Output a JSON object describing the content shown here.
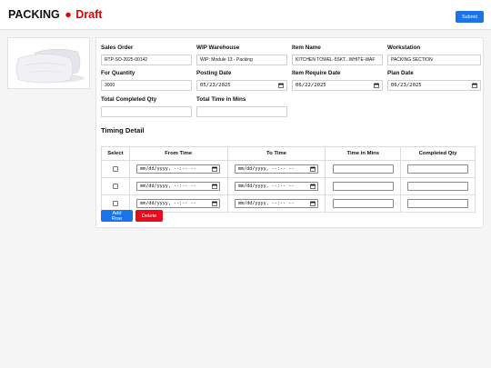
{
  "header": {
    "title": "PACKING",
    "status_dot": "●",
    "status": "Draft",
    "submit_label": "Submit"
  },
  "form": {
    "sales_order": {
      "label": "Sales Order",
      "value": "RTP-SO-2025-00142"
    },
    "wip_warehouse": {
      "label": "WIP Warehouse",
      "value": "WIP: Module 13 - Packing"
    },
    "item_name": {
      "label": "Item Name",
      "value": "KITCHEN TOWEL-5SKT...WHITE-WAF"
    },
    "workstation": {
      "label": "Workstation",
      "value": "PACKING SECTION"
    },
    "for_quantity": {
      "label": "For Quantity",
      "value": "3000"
    },
    "posting_date": {
      "label": "Posting Date",
      "value": "05/23/2025"
    },
    "item_require_date": {
      "label": "Item Require Date",
      "value": "06/22/2025"
    },
    "plan_date": {
      "label": "Plan Date",
      "value": "06/23/2025"
    },
    "total_completed_qty": {
      "label": "Total Completed Qty",
      "value": ""
    },
    "total_time_in_mins": {
      "label": "Total Time in Mins",
      "value": ""
    }
  },
  "timing": {
    "title": "Timing Detail",
    "columns": [
      "Select",
      "From Time",
      "To Time",
      "Time in Mins",
      "Completed Qty"
    ],
    "datetime_placeholder": "mm/dd/yyyy, --:-- --",
    "rows": [
      {
        "from": "",
        "to": "",
        "mins": "",
        "qty": ""
      },
      {
        "from": "",
        "to": "",
        "mins": "",
        "qty": ""
      },
      {
        "from": "",
        "to": "",
        "mins": "",
        "qty": ""
      }
    ],
    "add_row_label": "Add Row",
    "delete_label": "Delete"
  },
  "icons": {
    "calendar": "calendar-icon",
    "product_image": "pillow-image"
  },
  "colors": {
    "primary": "#1a73e8",
    "danger": "#e8091b",
    "status": "#e00000"
  }
}
